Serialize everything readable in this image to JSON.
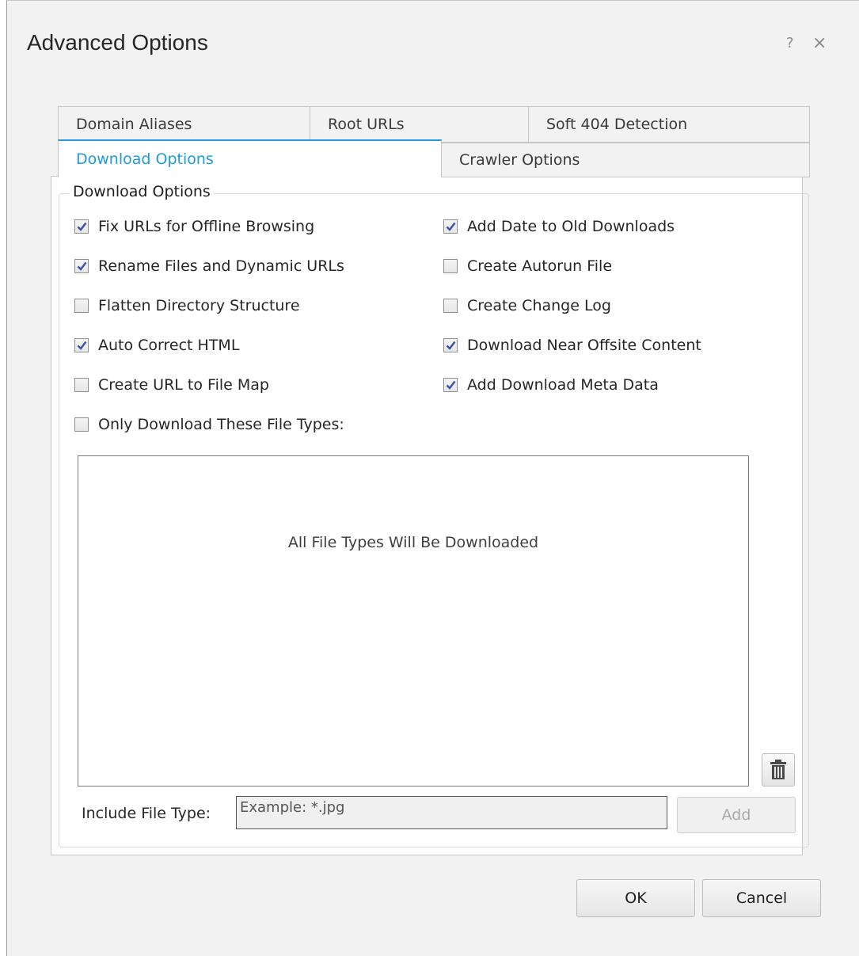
{
  "dialog": {
    "title": "Advanced Options",
    "help_label": "?",
    "close_label": "×"
  },
  "tabs": {
    "domain_aliases": "Domain Aliases",
    "root_urls": "Root URLs",
    "soft_404": "Soft 404 Detection",
    "download_options": "Download Options",
    "crawler_options": "Crawler Options",
    "active": "Download Options"
  },
  "group": {
    "title": "Download Options",
    "left_options": [
      {
        "label": "Fix URLs for Offline Browsing",
        "checked": true
      },
      {
        "label": "Rename Files and Dynamic URLs",
        "checked": true
      },
      {
        "label": "Flatten Directory Structure",
        "checked": false
      },
      {
        "label": "Auto Correct HTML",
        "checked": true
      },
      {
        "label": "Create URL to File Map",
        "checked": false
      },
      {
        "label": "Only Download These File Types:",
        "checked": false
      }
    ],
    "right_options": [
      {
        "label": "Add Date to Old Downloads",
        "checked": true
      },
      {
        "label": "Create Autorun File",
        "checked": false
      },
      {
        "label": "Create Change Log",
        "checked": false
      },
      {
        "label": "Download Near Offsite Content",
        "checked": true
      },
      {
        "label": "Add Download Meta Data",
        "checked": true
      }
    ]
  },
  "file_types": {
    "empty_message": "All File Types Will Be Downloaded",
    "include_label": "Include File Type:",
    "include_placeholder": "Example: *.jpg",
    "add_label": "Add"
  },
  "buttons": {
    "ok": "OK",
    "cancel": "Cancel"
  },
  "colors": {
    "accent": "#1e9ae0",
    "check": "#3a52a8"
  }
}
